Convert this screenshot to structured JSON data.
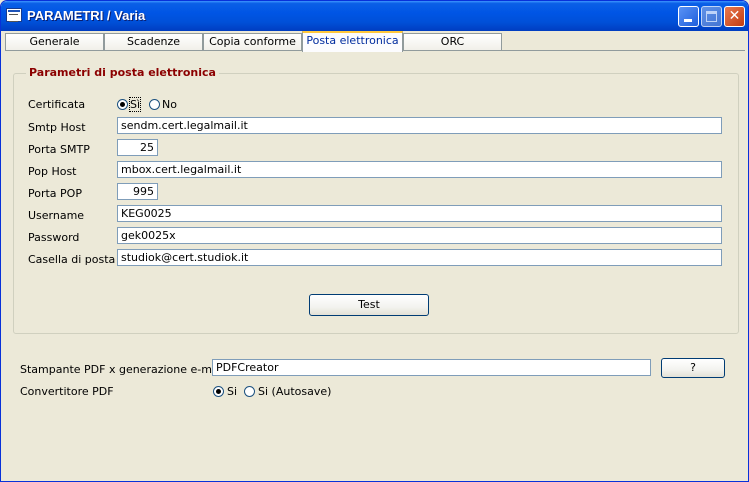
{
  "window": {
    "title": "PARAMETRI / Varia"
  },
  "tabs": [
    {
      "label": "Generale"
    },
    {
      "label": "Scadenze"
    },
    {
      "label": "Copia conforme"
    },
    {
      "label": "Posta elettronica"
    },
    {
      "label": "ORC"
    }
  ],
  "email": {
    "group_title": "Parametri di posta elettronica",
    "certificata_label": "Certificata",
    "certificata_options": [
      "Sì",
      "No"
    ],
    "certificata_selected": "Sì",
    "smtp_host_label": "Smtp Host",
    "smtp_host_value": "sendm.cert.legalmail.it",
    "porta_smtp_label": "Porta SMTP",
    "porta_smtp_value": "25",
    "pop_host_label": "Pop Host",
    "pop_host_value": "mbox.cert.legalmail.it",
    "porta_pop_label": "Porta POP",
    "porta_pop_value": "995",
    "username_label": "Username",
    "username_value": "KEG0025",
    "password_label": "Password",
    "password_value": "gek0025x",
    "casella_label": "Casella di posta",
    "casella_value": "studiok@cert.studiok.it",
    "test_button": "Test"
  },
  "pdf": {
    "printer_label": "Stampante PDF x generazione e-mail",
    "printer_value": "PDFCreator",
    "browse_button": "?",
    "converter_label": "Convertitore PDF",
    "converter_options": [
      "Si",
      "Si (Autosave)"
    ],
    "converter_selected": "Si"
  }
}
